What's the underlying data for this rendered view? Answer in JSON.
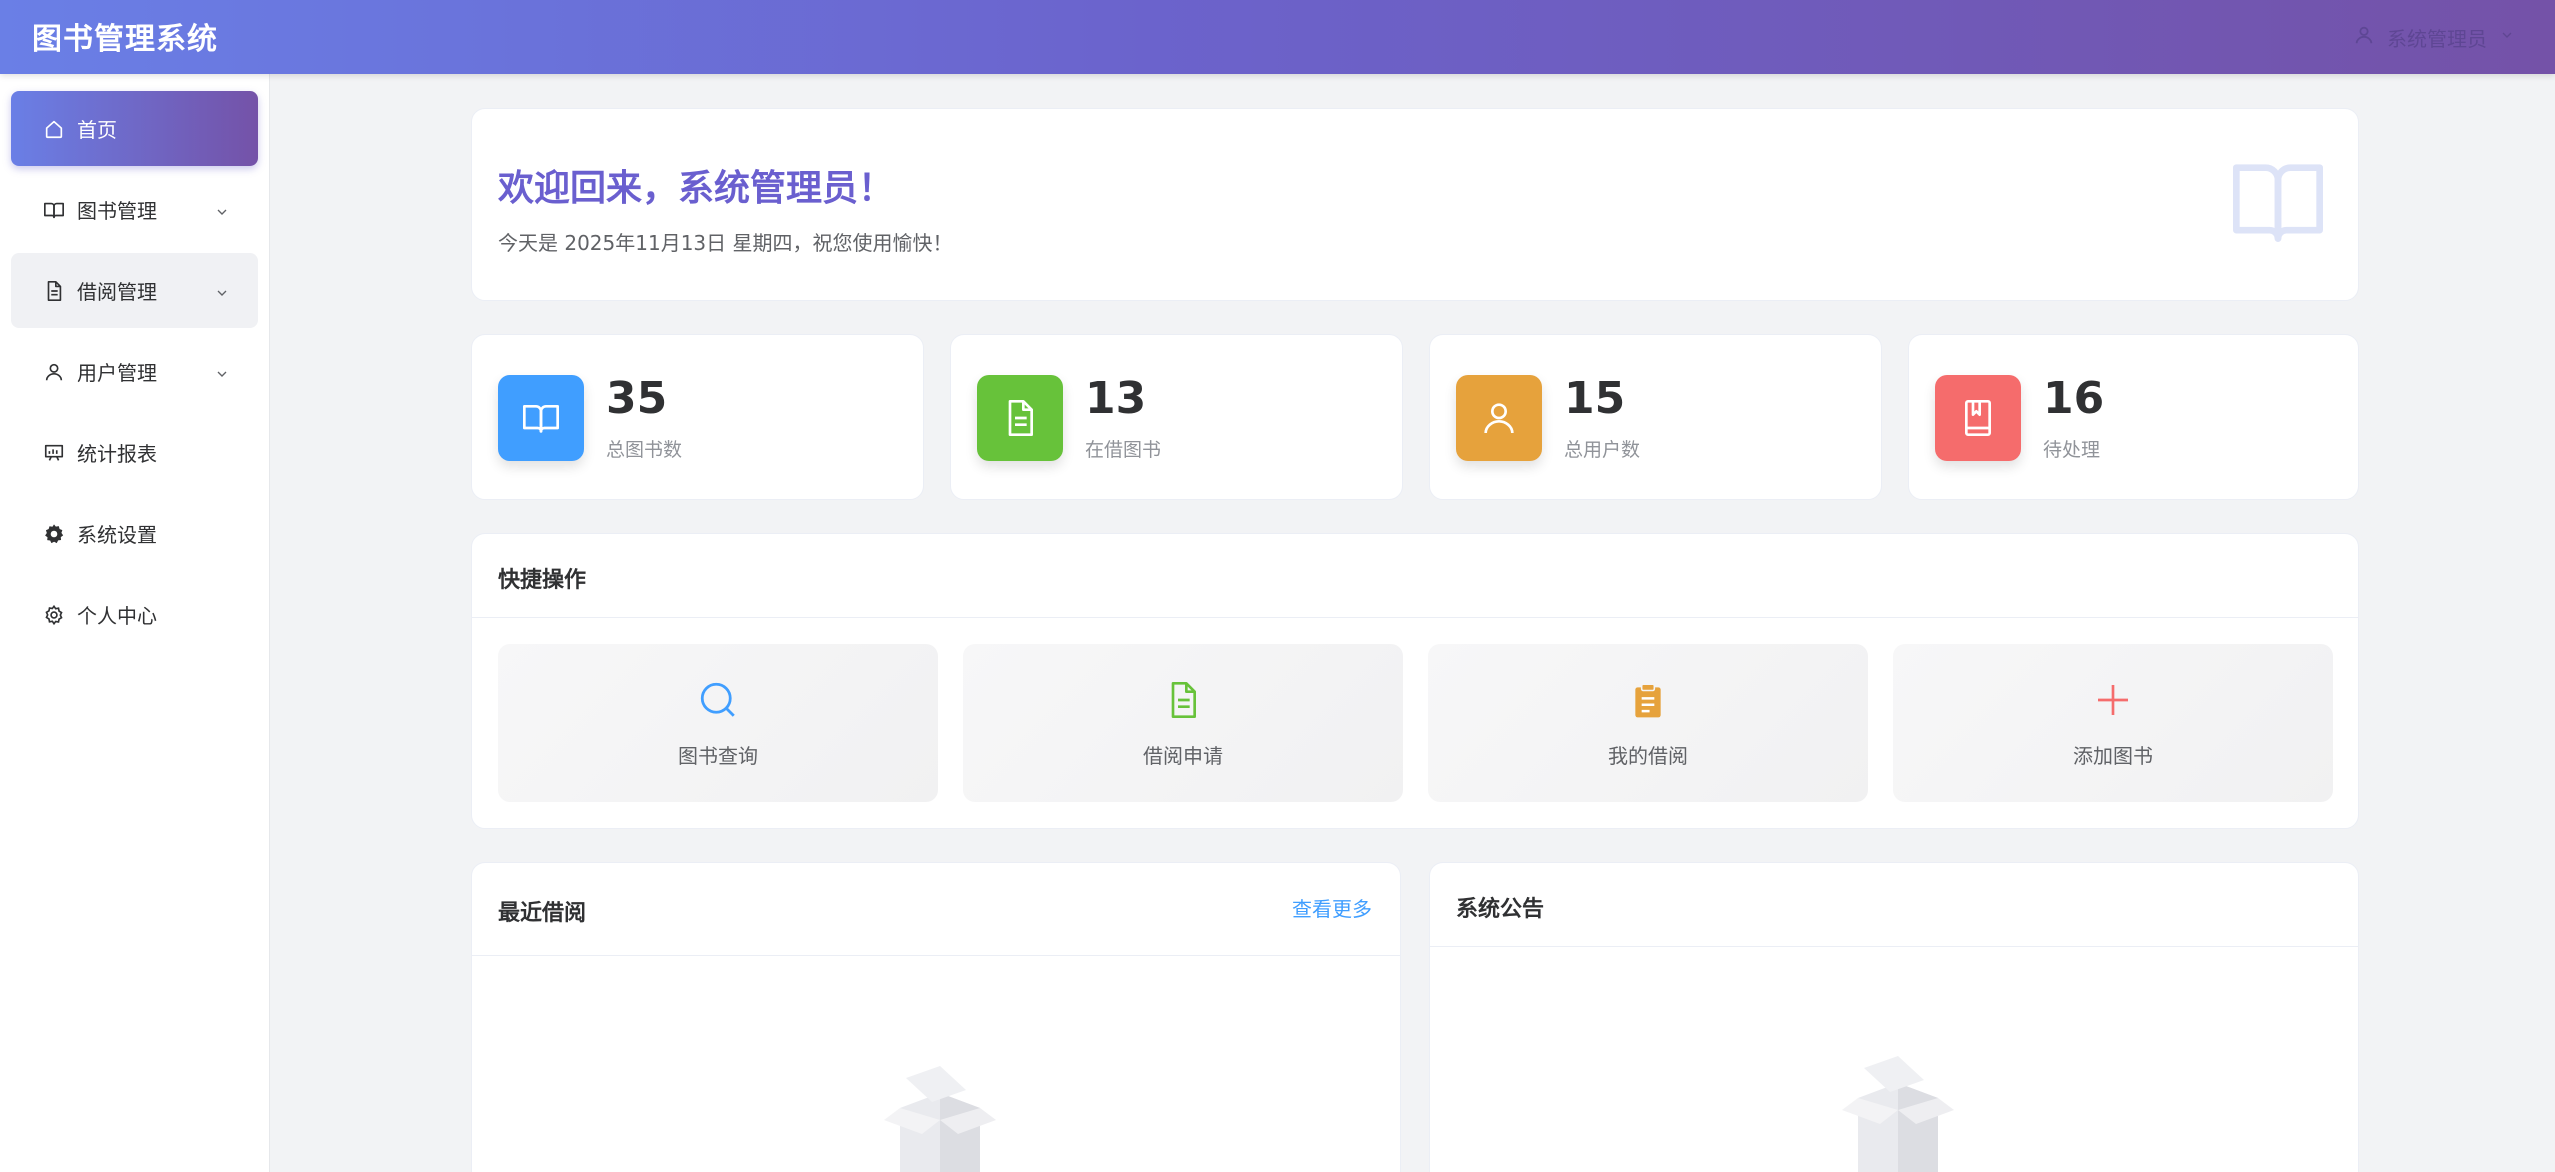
{
  "app": {
    "title": "图书管理系统"
  },
  "header": {
    "user_name": "系统管理员"
  },
  "sidebar": {
    "items": [
      {
        "label": "首页",
        "icon": "home-icon",
        "active": true,
        "expandable": false
      },
      {
        "label": "图书管理",
        "icon": "book-icon",
        "active": false,
        "expandable": true
      },
      {
        "label": "借阅管理",
        "icon": "document-icon",
        "active": false,
        "expandable": true
      },
      {
        "label": "用户管理",
        "icon": "user-icon",
        "active": false,
        "expandable": true
      },
      {
        "label": "统计报表",
        "icon": "chart-icon",
        "active": false,
        "expandable": false
      },
      {
        "label": "系统设置",
        "icon": "gear-filled-icon",
        "active": false,
        "expandable": false
      },
      {
        "label": "个人中心",
        "icon": "settings-icon",
        "active": false,
        "expandable": false
      }
    ]
  },
  "welcome": {
    "title": "欢迎回来，系统管理员！",
    "subtitle": "今天是 2025年11月13日 星期四，祝您使用愉快！"
  },
  "stats": [
    {
      "value": "35",
      "label": "总图书数",
      "color": "#409eff",
      "icon": "book-icon"
    },
    {
      "value": "13",
      "label": "在借图书",
      "color": "#67c23a",
      "icon": "document-icon"
    },
    {
      "value": "15",
      "label": "总用户数",
      "color": "#e6a23c",
      "icon": "user-icon"
    },
    {
      "value": "16",
      "label": "待处理",
      "color": "#f56c6c",
      "icon": "notebook-icon"
    }
  ],
  "quick_actions": {
    "title": "快捷操作",
    "items": [
      {
        "label": "图书查询",
        "icon": "search-icon",
        "color": "#409eff"
      },
      {
        "label": "借阅申请",
        "icon": "document-icon",
        "color": "#67c23a"
      },
      {
        "label": "我的借阅",
        "icon": "clipboard-icon",
        "color": "#e6a23c"
      },
      {
        "label": "添加图书",
        "icon": "plus-icon",
        "color": "#f56c6c"
      }
    ]
  },
  "recent_borrow": {
    "title": "最近借阅",
    "more_link": "查看更多"
  },
  "announcements": {
    "title": "系统公告"
  }
}
